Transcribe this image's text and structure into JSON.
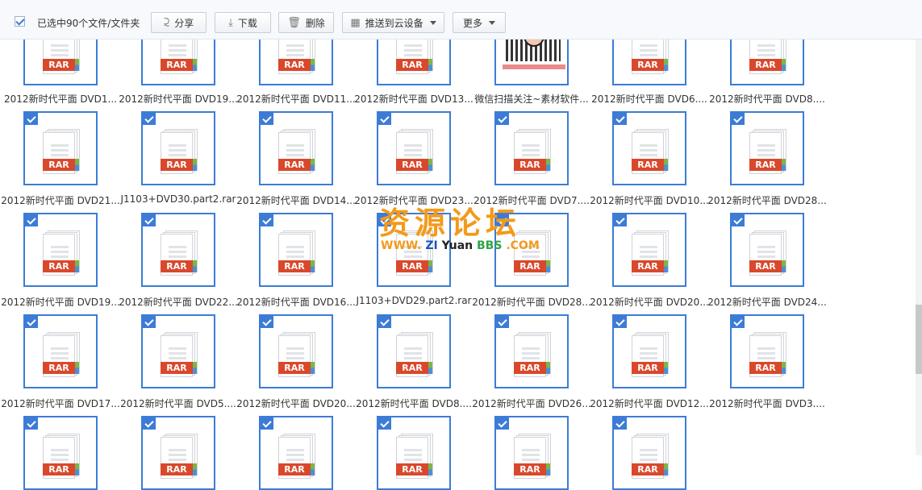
{
  "toolbar": {
    "selection_label": "已选中90个文件/文件夹",
    "share_label": "分享",
    "download_label": "下载",
    "delete_label": "删除",
    "push_label": "推送到云设备",
    "more_label": "更多"
  },
  "file_badge": "RAR",
  "rows": [
    {
      "names": [
        "2012新时代平面 DVD1...",
        "2012新时代平面 DVD19...",
        "2012新时代平面 DVD11...",
        "2012新时代平面 DVD13...",
        "微信扫描关注~素材软件...",
        "2012新时代平面 DVD6....",
        "2012新时代平面 DVD8...."
      ]
    },
    {
      "names": [
        "2012新时代平面 DVD21...",
        "J1103+DVD30.part2.rar",
        "2012新时代平面 DVD14...",
        "2012新时代平面 DVD23...",
        "2012新时代平面 DVD7....",
        "2012新时代平面 DVD10...",
        "2012新时代平面 DVD28..."
      ]
    },
    {
      "names": [
        "2012新时代平面 DVD19...",
        "2012新时代平面 DVD22...",
        "2012新时代平面 DVD16...",
        "J1103+DVD29.part2.rar",
        "2012新时代平面 DVD28...",
        "2012新时代平面 DVD20...",
        "2012新时代平面 DVD24..."
      ]
    },
    {
      "names": [
        "2012新时代平面 DVD17...",
        "2012新时代平面 DVD5....",
        "2012新时代平面 DVD20...",
        "2012新时代平面 DVD8....",
        "2012新时代平面 DVD26...",
        "2012新时代平面 DVD12...",
        "2012新时代平面 DVD3...."
      ]
    }
  ],
  "watermark": {
    "title": "资源论坛",
    "url_www": "WWW.",
    "url_zi": "ZI",
    "url_yuan": "Yuan",
    "url_bbs": "BBS",
    "url_com": ".COM"
  },
  "colors": {
    "accent": "#3c7cd6",
    "rar_badge": "#d9482b",
    "watermark_orange": "#f39a1b"
  }
}
